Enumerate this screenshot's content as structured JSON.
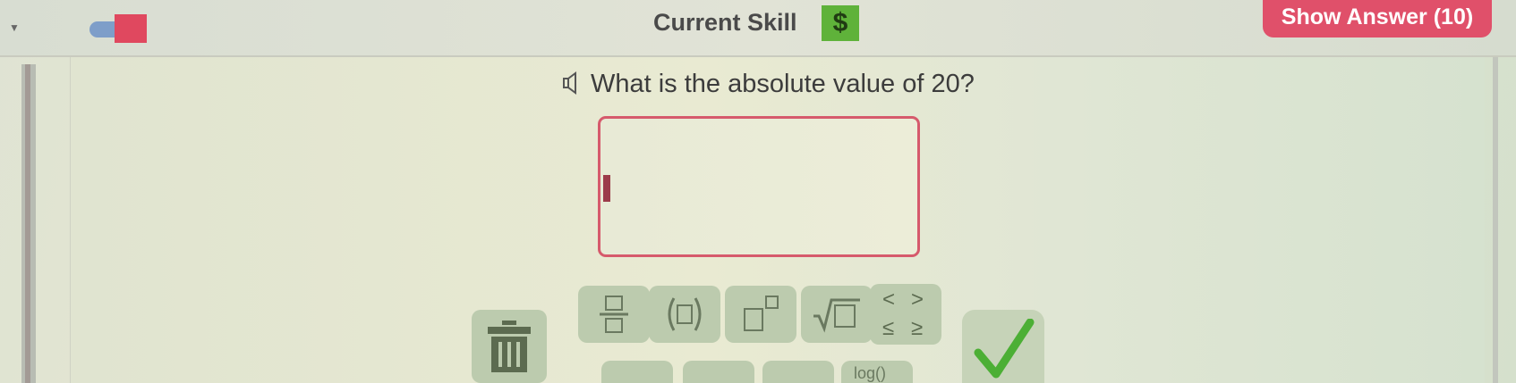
{
  "header": {
    "current_skill_label": "Current Skill",
    "currency_symbol": "$",
    "show_answer_label": "Show Answer (10)"
  },
  "question": {
    "text": "What is the absolute value of 20?"
  },
  "answer": {
    "value": ""
  },
  "keypad": {
    "ineq_lt": "<",
    "ineq_gt": ">",
    "ineq_le": "≤",
    "ineq_ge": "≥",
    "log_label": "log()"
  },
  "colors": {
    "accent_red": "#e0506a",
    "dollar_green": "#5fb23a",
    "key_green": "#bccbae"
  }
}
